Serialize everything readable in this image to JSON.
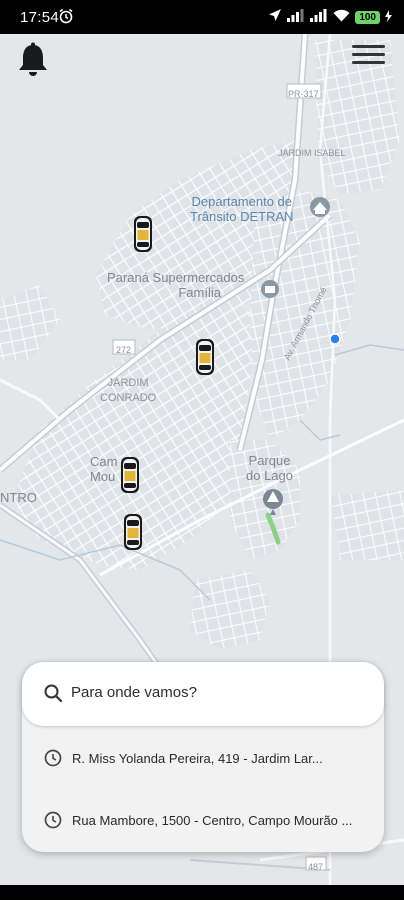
{
  "status_bar": {
    "time": "17:54",
    "battery": "100"
  },
  "map": {
    "labels": {
      "road_pr317": "PR-317",
      "jardim_isabel": "JARDIM ISABEL",
      "detran_line1": "Departamento de",
      "detran_line2": "Trânsito DETRAN",
      "parana_line1": "Paraná Supermercados",
      "parana_line2": "Família",
      "road_272": "272",
      "jardim_conrado_line1": "JARDIM",
      "jardim_conrado_line2": "CONRADO",
      "avenue": "Av. Armando Thomé",
      "campo_line1": "Cam",
      "campo_line2": "Mou",
      "parque_line1": "Parque",
      "parque_line2": "do Lago",
      "centro": "NTRO",
      "road_487": "487"
    }
  },
  "search": {
    "placeholder": "Para onde vamos?"
  },
  "recent_places": [
    {
      "address": "R. Miss Yolanda Pereira, 419 - Jardim Lar..."
    },
    {
      "address": "Rua Mambore, 1500 - Centro, Campo Mourão ..."
    }
  ]
}
